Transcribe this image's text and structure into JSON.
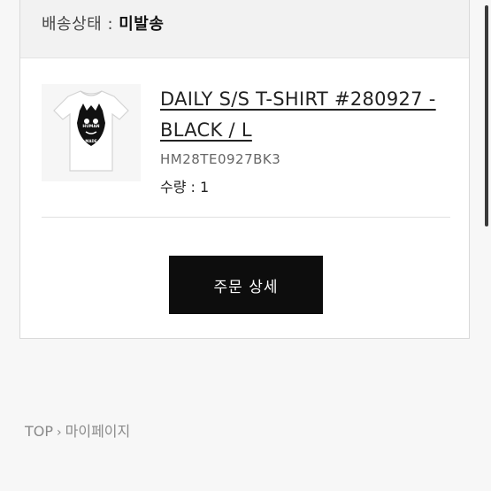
{
  "order": {
    "status_label": "배송상태 : ",
    "status_value": "미발송",
    "item": {
      "name": "DAILY S/S T-SHIRT #280927 - BLACK / L",
      "code": "HM28TE0927BK3",
      "quantity_text": "수량 : 1",
      "thumbnail_logo_text_top": "HUMAN",
      "thumbnail_logo_text_bottom": "MADE"
    },
    "detail_button_label": "주문 상세"
  },
  "breadcrumb": {
    "home": "TOP",
    "separator": "›",
    "current": "마이페이지"
  },
  "colors": {
    "button_bg": "#0d0d0d",
    "status_bg": "#f2f2f2",
    "breadcrumb_text": "#8a8a8a"
  }
}
